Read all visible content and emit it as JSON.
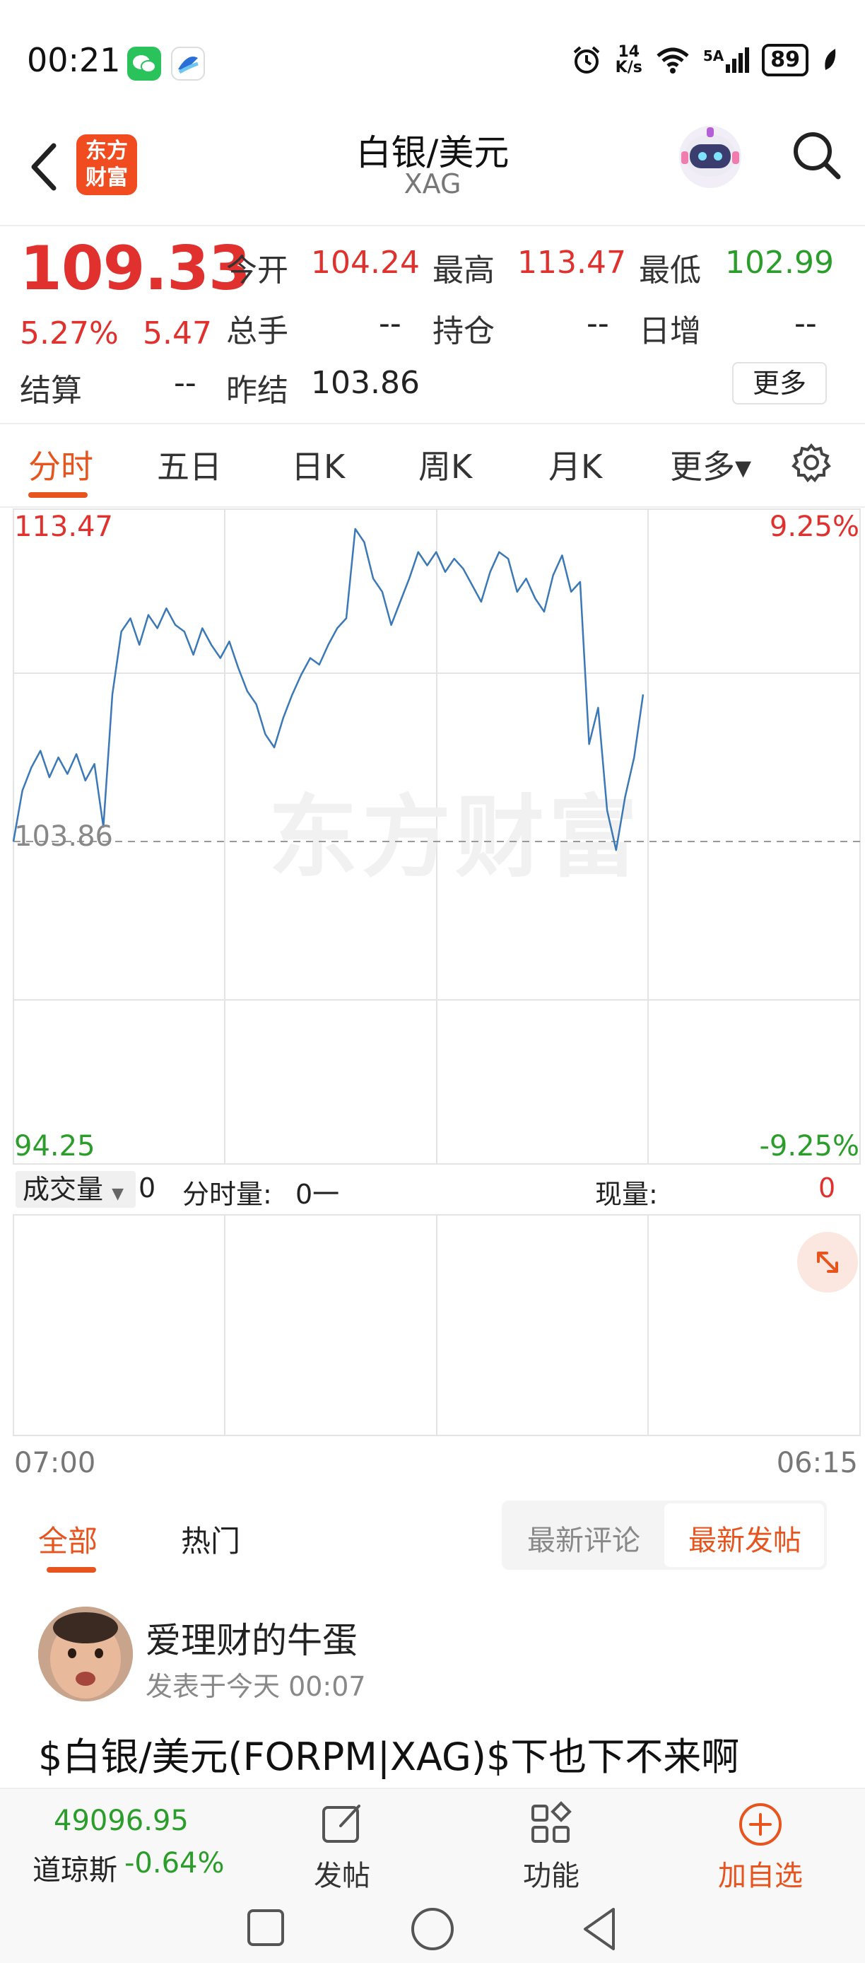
{
  "status_bar": {
    "time": "00:21",
    "net_speed_top": "14",
    "net_speed_bottom": "K/s",
    "signal_label": "5A",
    "battery": "89"
  },
  "header": {
    "back_icon": "chevron-left-icon",
    "brand_line1": "东方",
    "brand_line2": "财富",
    "title": "白银/美元",
    "subtitle": "XAG",
    "search_icon": "search-icon"
  },
  "quote": {
    "price": "109.33",
    "change_pct": "5.27%",
    "change_abs": "5.47",
    "open_label": "今开",
    "open_value": "104.24",
    "high_label": "最高",
    "high_value": "113.47",
    "low_label": "最低",
    "low_value": "102.99",
    "volume_label": "总手",
    "volume_value": "--",
    "oi_label": "持仓",
    "oi_value": "--",
    "daily_inc_label": "日增",
    "daily_inc_value": "--",
    "settle_label": "结算",
    "settle_value": "--",
    "prev_settle_label": "昨结",
    "prev_settle_value": "103.86",
    "more_label": "更多"
  },
  "chart_tabs": [
    {
      "label": "分时",
      "active": true
    },
    {
      "label": "五日"
    },
    {
      "label": "日K"
    },
    {
      "label": "周K"
    },
    {
      "label": "月K"
    },
    {
      "label": "更多▾"
    }
  ],
  "chart_data": {
    "type": "line",
    "y_max_label": "113.47",
    "y_min_label": "94.25",
    "ref_label": "103.86",
    "pct_max_label": "9.25%",
    "pct_min_label": "-9.25%",
    "ylim": [
      94.25,
      113.47
    ],
    "reference": 103.86,
    "x_start_label": "07:00",
    "x_end_label": "06:15",
    "watermark": "东方财富",
    "series": [
      {
        "values": [
          103.86,
          105.4,
          106.1,
          106.6,
          105.8,
          106.4,
          105.9,
          106.5,
          105.7,
          106.2,
          104.3,
          108.3,
          110.2,
          110.6,
          109.8,
          110.7,
          110.3,
          110.9,
          110.4,
          110.2,
          109.5,
          110.3,
          109.8,
          109.4,
          109.9,
          109.1,
          108.4,
          108.0,
          107.1,
          106.7,
          107.6,
          108.3,
          108.9,
          109.4,
          109.2,
          109.8,
          110.3,
          110.6,
          113.3,
          112.9,
          111.8,
          111.4,
          110.4,
          111.1,
          111.8,
          112.6,
          112.2,
          112.6,
          112.0,
          112.4,
          112.1,
          111.6,
          111.1,
          112.0,
          112.6,
          112.4,
          111.4,
          111.8,
          111.2,
          110.8,
          111.9,
          112.5,
          111.4,
          111.7,
          106.8,
          107.9,
          104.8,
          103.6,
          105.2,
          106.4,
          108.3
        ]
      }
    ]
  },
  "volume_bar": {
    "select_label": "成交量",
    "select_value": "0",
    "tick_vol_label": "分时量:",
    "tick_vol_value": "0一",
    "current_label": "现量:",
    "current_value": "0"
  },
  "feed": {
    "tabs": [
      {
        "label": "全部",
        "active": true
      },
      {
        "label": "热门"
      }
    ],
    "sort_options": [
      {
        "label": "最新评论"
      },
      {
        "label": "最新发帖",
        "active": true
      }
    ]
  },
  "post": {
    "author": "爱理财的牛蛋",
    "meta": "发表于今天 00:07",
    "body": "$白银/美元(FORPM|XAG)$下也下不来啊"
  },
  "bottom_bar": {
    "index_value": "49096.95",
    "index_name": "道琼斯",
    "index_change": "-0.64%",
    "nav": [
      {
        "label": "发帖",
        "icon": "edit-icon"
      },
      {
        "label": "功能",
        "icon": "grid-icon"
      },
      {
        "label": "加自选",
        "icon": "add-circle-icon"
      }
    ]
  },
  "colors": {
    "up": "#e0312e",
    "down": "#2a9d2a",
    "accent": "#e8541d",
    "line": "#3b78b7"
  }
}
